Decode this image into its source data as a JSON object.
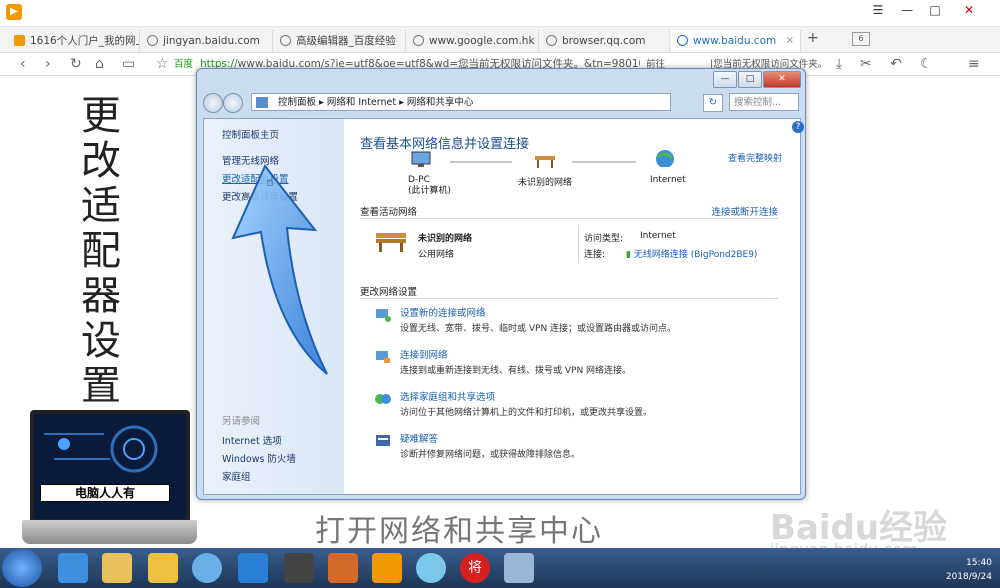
{
  "browser": {
    "logo_mark": "▶",
    "controls": {
      "menu": "☰",
      "pin": "⚑",
      "minimize": "—",
      "maximize": "□",
      "close": "✕"
    },
    "tabs": [
      {
        "title": "1616个人门户_我的网上第",
        "icon": "orange-app-icon"
      },
      {
        "title": "jingyan.baidu.com",
        "icon": "globe-icon"
      },
      {
        "title": "高级编辑器_百度经验",
        "icon": "globe-icon"
      },
      {
        "title": "www.google.com.hk",
        "icon": "globe-icon"
      },
      {
        "title": "browser.qq.com",
        "icon": "globe-icon"
      },
      {
        "title": "www.baidu.com",
        "icon": "globe-icon",
        "active": true
      }
    ],
    "tab_close": "×",
    "new_tab": "+",
    "tab_count": "6",
    "nav_glyphs": {
      "back": "‹",
      "forward": "›",
      "reload": "↻",
      "home": "⌂",
      "reader": "▭",
      "favorite": "☆",
      "download": "⤓",
      "cut": "✂",
      "undo": "↶",
      "night": "☾",
      "more": "≡",
      "forward_ext": "前往"
    },
    "address": {
      "site": "百度",
      "secure_part": "https://",
      "url": "www.baidu.com/s?ie=utf8&oe=utf8&wd=您当前无权限访问文件夹。&tn=98010",
      "right_text": "前往",
      "hint": "|您当前无权限访问文件夹。"
    }
  },
  "left_title": [
    "更",
    "改",
    "适",
    "配",
    "器",
    "设",
    "置"
  ],
  "laptop_label": "电脑人人有",
  "caption": "打开网络和共享中心",
  "watermark": {
    "logo": "Baidu经验",
    "url": "jingyan.baidu.com"
  },
  "window": {
    "controls": {
      "min": "—",
      "max": "□",
      "close": "✕"
    },
    "breadcrumb": [
      "控制面板",
      "网络和 Internet",
      "网络和共享中心"
    ],
    "search_placeholder": "搜索控制...",
    "help": "?",
    "sidebar": {
      "items": [
        "控制面板主页",
        "管理无线网络",
        "更改适配器设置",
        "更改高级共享设置"
      ],
      "see_also_label": "另请参阅",
      "see_also": [
        "Internet 选项",
        "Windows 防火墙",
        "家庭组"
      ]
    },
    "main": {
      "heading": "查看基本网络信息并设置连接",
      "full_map_link": "查看完整映射",
      "nodes": [
        {
          "name": "D-PC",
          "sub": "(此计算机)"
        },
        {
          "name": "未识别的网络",
          "sub": ""
        },
        {
          "name": "Internet",
          "sub": ""
        }
      ],
      "active_section": "查看活动网络",
      "connect_link": "连接或断开连接",
      "network": {
        "name": "未识别的网络",
        "type": "公用网络"
      },
      "access_label": "访问类型:",
      "access_value": "Internet",
      "conn_label": "连接:",
      "conn_value": "无线网络连接 (BigPond2BE9)",
      "change_section": "更改网络设置",
      "tasks": [
        {
          "title": "设置新的连接或网络",
          "desc": "设置无线、宽带、拨号、临时或 VPN 连接；或设置路由器或访问点。"
        },
        {
          "title": "连接到网络",
          "desc": "连接到或重新连接到无线、有线、拨号或 VPN 网络连接。"
        },
        {
          "title": "选择家庭组和共享选项",
          "desc": "访问位于其他网络计算机上的文件和打印机，或更改共享设置。"
        },
        {
          "title": "疑难解答",
          "desc": "诊断并修复网络问题，或获得故障排除信息。"
        }
      ]
    }
  },
  "taskbar": {
    "time": "15:40",
    "date": "2018/9/24",
    "tray_lang": "将"
  }
}
